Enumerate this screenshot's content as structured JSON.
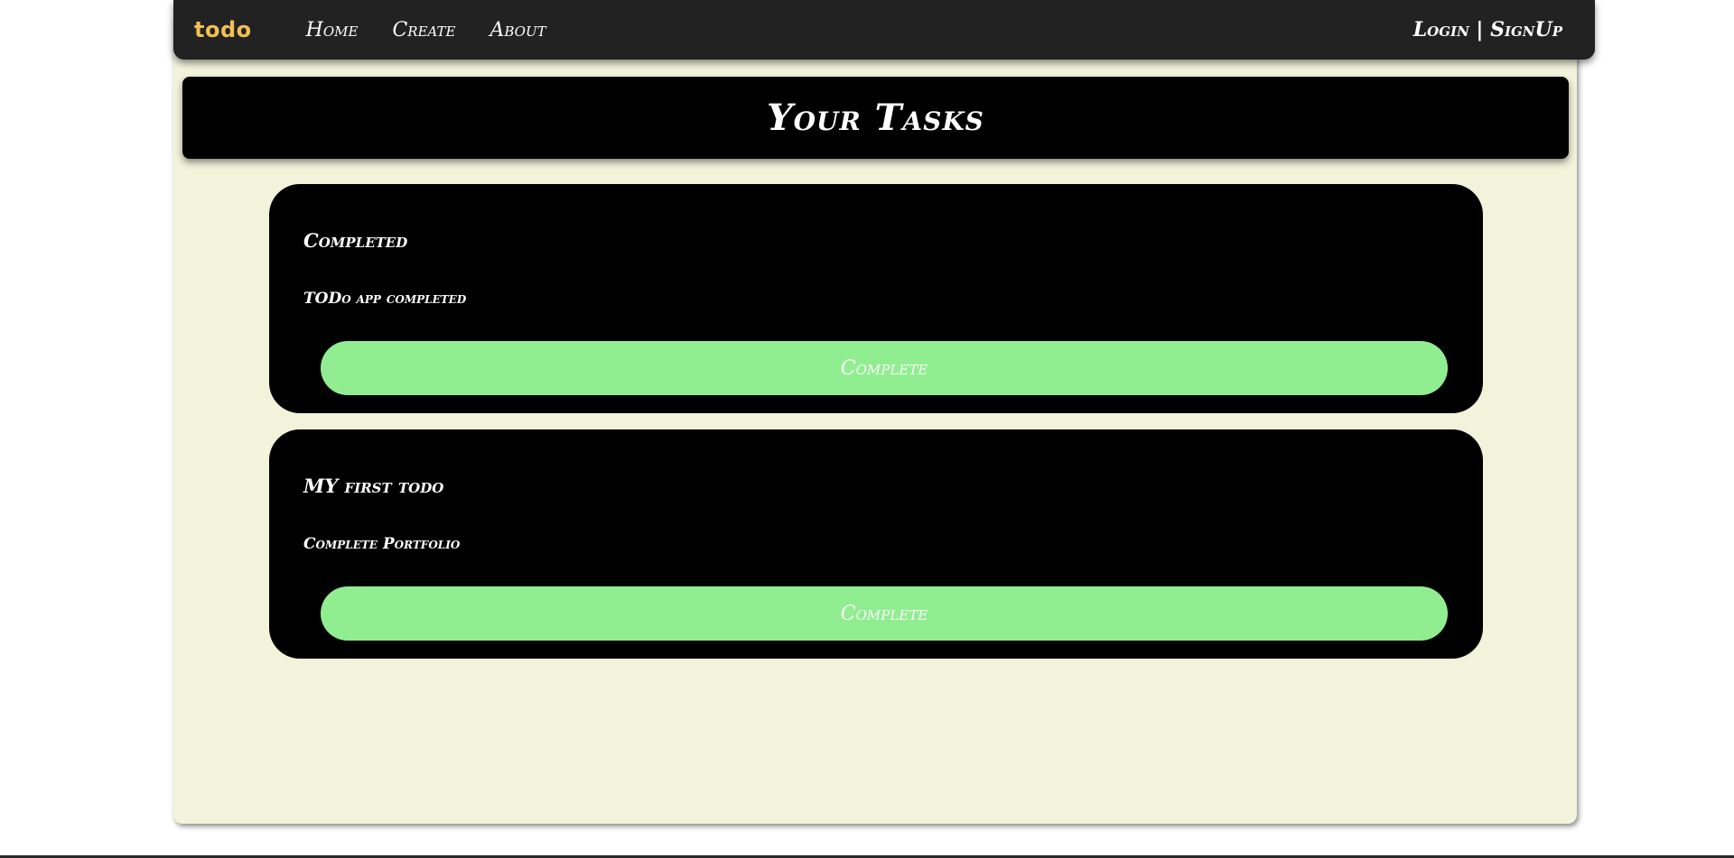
{
  "navbar": {
    "brand": "todo",
    "links": [
      {
        "label": "Home"
      },
      {
        "label": "Create"
      },
      {
        "label": "About"
      }
    ],
    "auth_label": "Login | SignUp"
  },
  "page_title": "Your Tasks",
  "tasks": [
    {
      "title": "Completed",
      "description": "TODo app completed",
      "button_label": "Complete"
    },
    {
      "title": "MY first todo",
      "description": "Complete Portfolio",
      "button_label": "Complete"
    }
  ],
  "colors": {
    "navbar_bg": "#222222",
    "brand": "#f2bf55",
    "page_bg": "#f3f3dc",
    "card_bg": "#000000",
    "button_bg": "#90ee90"
  }
}
